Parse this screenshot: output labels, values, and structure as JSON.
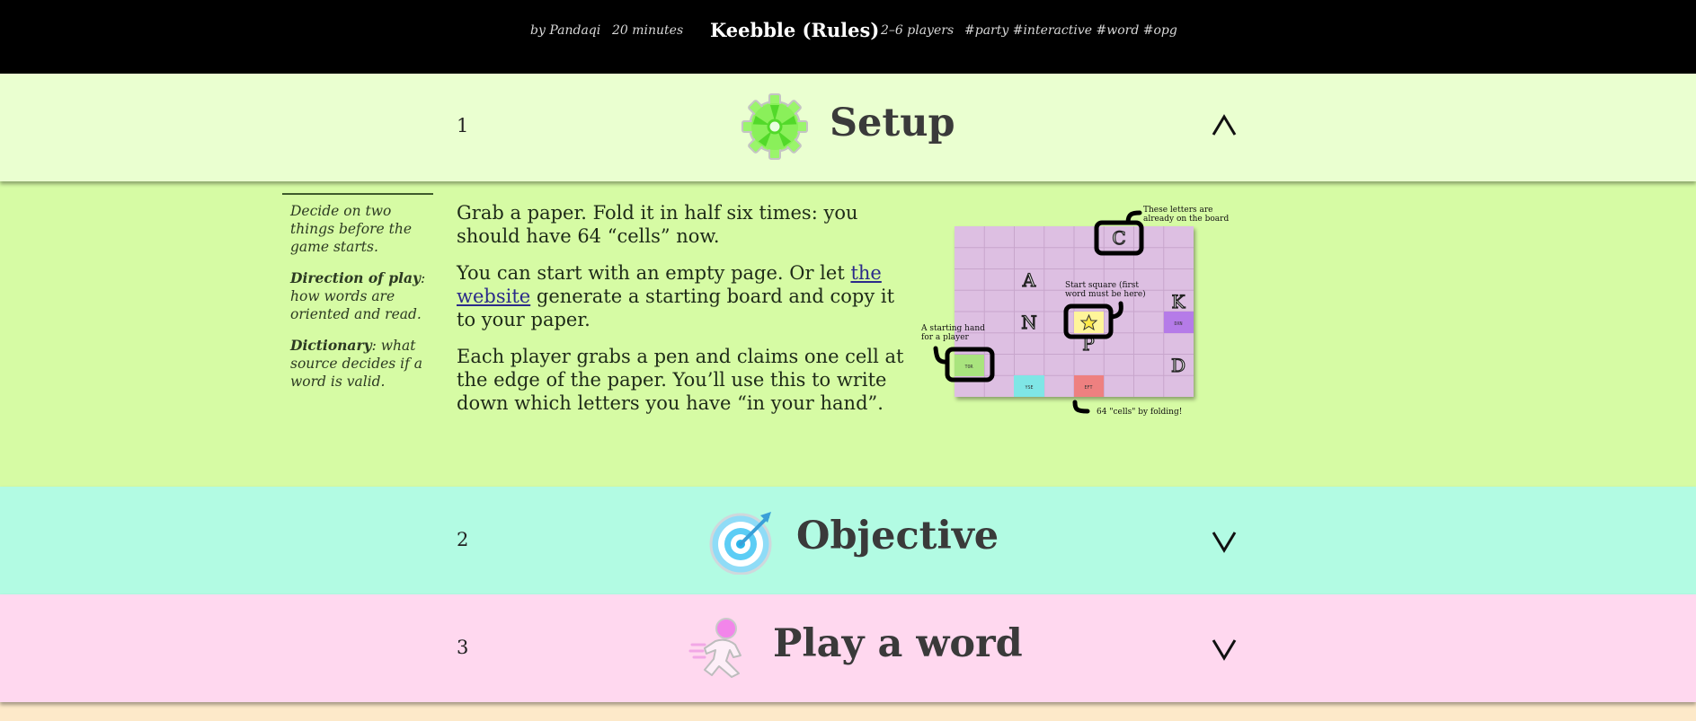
{
  "header": {
    "author": "by Pandaqi",
    "duration": "20 minutes",
    "title": "Keebble (Rules)",
    "players": "2–6 players",
    "tags": "#party #interactive #word #opg"
  },
  "sections": [
    {
      "number": "1",
      "title": "Setup",
      "icon": "gear-icon",
      "state": "expanded",
      "color": "#eaffd0"
    },
    {
      "number": "2",
      "title": "Objective",
      "icon": "target-icon",
      "state": "collapsed",
      "color": "#b2fbe3"
    },
    {
      "number": "3",
      "title": "Play a word",
      "icon": "running-person-icon",
      "state": "collapsed",
      "color": "#ffd8ef"
    }
  ],
  "setup": {
    "sidenote": {
      "intro": "Decide on two things before the game starts.",
      "item1_term": "Direction of play",
      "item1_text": ": how words are oriented and read.",
      "item2_term": "Dictionary",
      "item2_text": ": what source decides if a word is valid."
    },
    "para1": "Grab a paper. Fold it in half six times: you should have 64 “cells” now.",
    "para2_before": "You can start with an empty page. Or let ",
    "para2_link": "the website",
    "para2_after": " generate a starting board and copy it to your paper.",
    "para3": "Each player grabs a pen and claims one cell at the edge of the paper. You’ll use this to write down which letters you have “in your hand”.",
    "board": {
      "annotation_letters": "These letters are already on the board",
      "annotation_start": "Start square (first word must be here)",
      "annotation_hand": "A starting hand for a player",
      "annotation_cells": "64 \"cells\" by folding!",
      "letters": [
        "C",
        "A",
        "K",
        "N",
        "P",
        "D"
      ],
      "hand_cells": [
        "TOR",
        "YSE",
        "EFT",
        "DXN"
      ]
    }
  }
}
